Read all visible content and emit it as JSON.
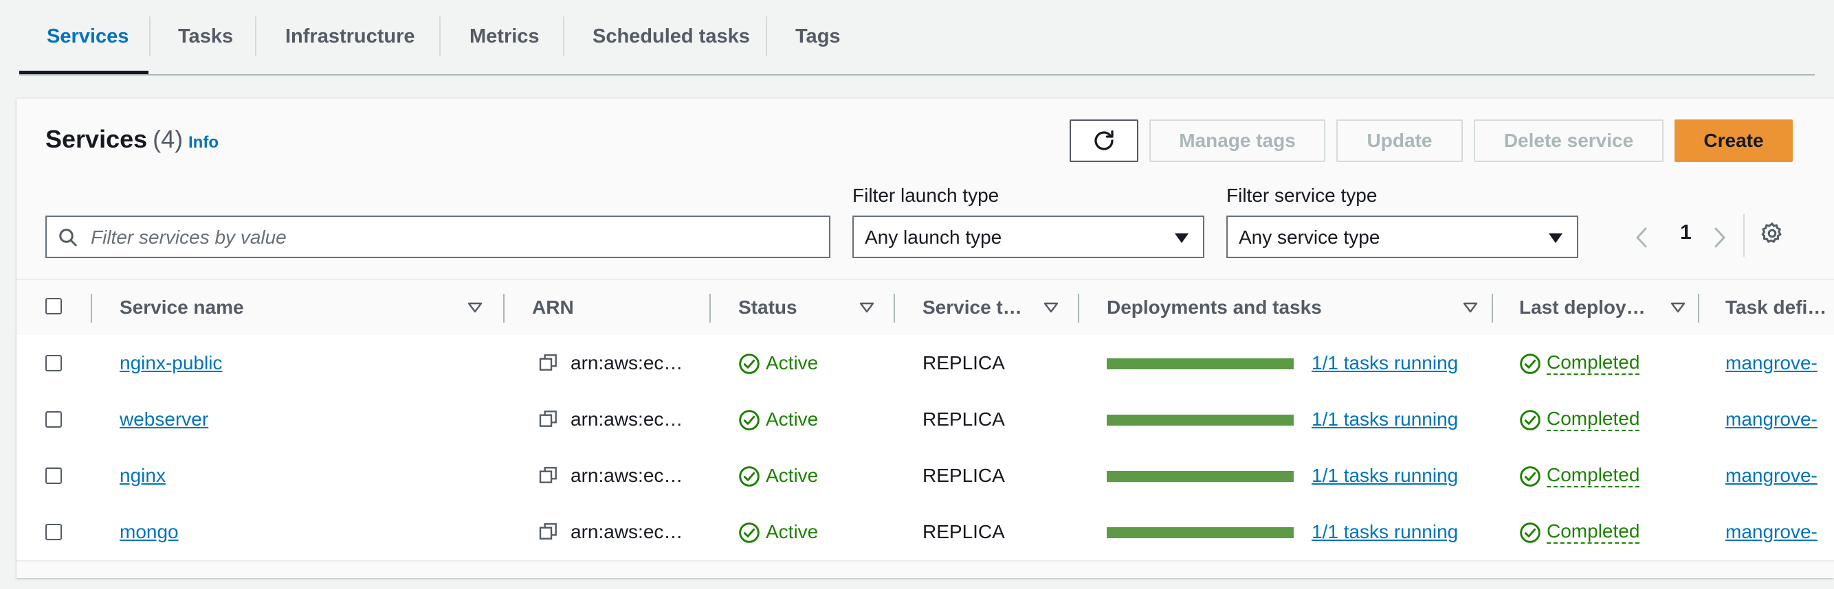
{
  "tabs": [
    {
      "label": "Services",
      "active": true
    },
    {
      "label": "Tasks"
    },
    {
      "label": "Infrastructure"
    },
    {
      "label": "Metrics"
    },
    {
      "label": "Scheduled tasks"
    },
    {
      "label": "Tags"
    }
  ],
  "panel": {
    "title": "Services",
    "count": "(4)",
    "info": "Info"
  },
  "toolbar": {
    "refresh_icon": "refresh-icon",
    "manage_tags": "Manage tags",
    "update": "Update",
    "delete_service": "Delete service",
    "create": "Create"
  },
  "filters": {
    "search_placeholder": "Filter services by value",
    "launch_type_label": "Filter launch type",
    "launch_type_value": "Any launch type",
    "service_type_label": "Filter service type",
    "service_type_value": "Any service type"
  },
  "pagination": {
    "page": "1"
  },
  "table": {
    "columns": {
      "service_name": "Service name",
      "arn": "ARN",
      "status": "Status",
      "service_type": "Service t…",
      "deployments": "Deployments and tasks",
      "last_deploy": "Last deploy…",
      "task_def": "Task defi…"
    },
    "rows": [
      {
        "name": "nginx-public",
        "arn": "arn:aws:ec…",
        "status": "Active",
        "type": "REPLICA",
        "tasks_text": "1/1 tasks running",
        "tasks_fraction": 1.0,
        "deploy": "Completed",
        "task_def": "mangrove-"
      },
      {
        "name": "webserver",
        "arn": "arn:aws:ec…",
        "status": "Active",
        "type": "REPLICA",
        "tasks_text": "1/1 tasks running",
        "tasks_fraction": 1.0,
        "deploy": "Completed",
        "task_def": "mangrove-"
      },
      {
        "name": "nginx",
        "arn": "arn:aws:ec…",
        "status": "Active",
        "type": "REPLICA",
        "tasks_text": "1/1 tasks running",
        "tasks_fraction": 1.0,
        "deploy": "Completed",
        "task_def": "mangrove-"
      },
      {
        "name": "mongo",
        "arn": "arn:aws:ec…",
        "status": "Active",
        "type": "REPLICA",
        "tasks_text": "1/1 tasks running",
        "tasks_fraction": 1.0,
        "deploy": "Completed",
        "task_def": "mangrove-"
      }
    ]
  },
  "colors": {
    "accent": "#0073bb",
    "primary_button": "#ec9434",
    "success": "#1d8102",
    "progress_bar": "#5c9a46"
  }
}
